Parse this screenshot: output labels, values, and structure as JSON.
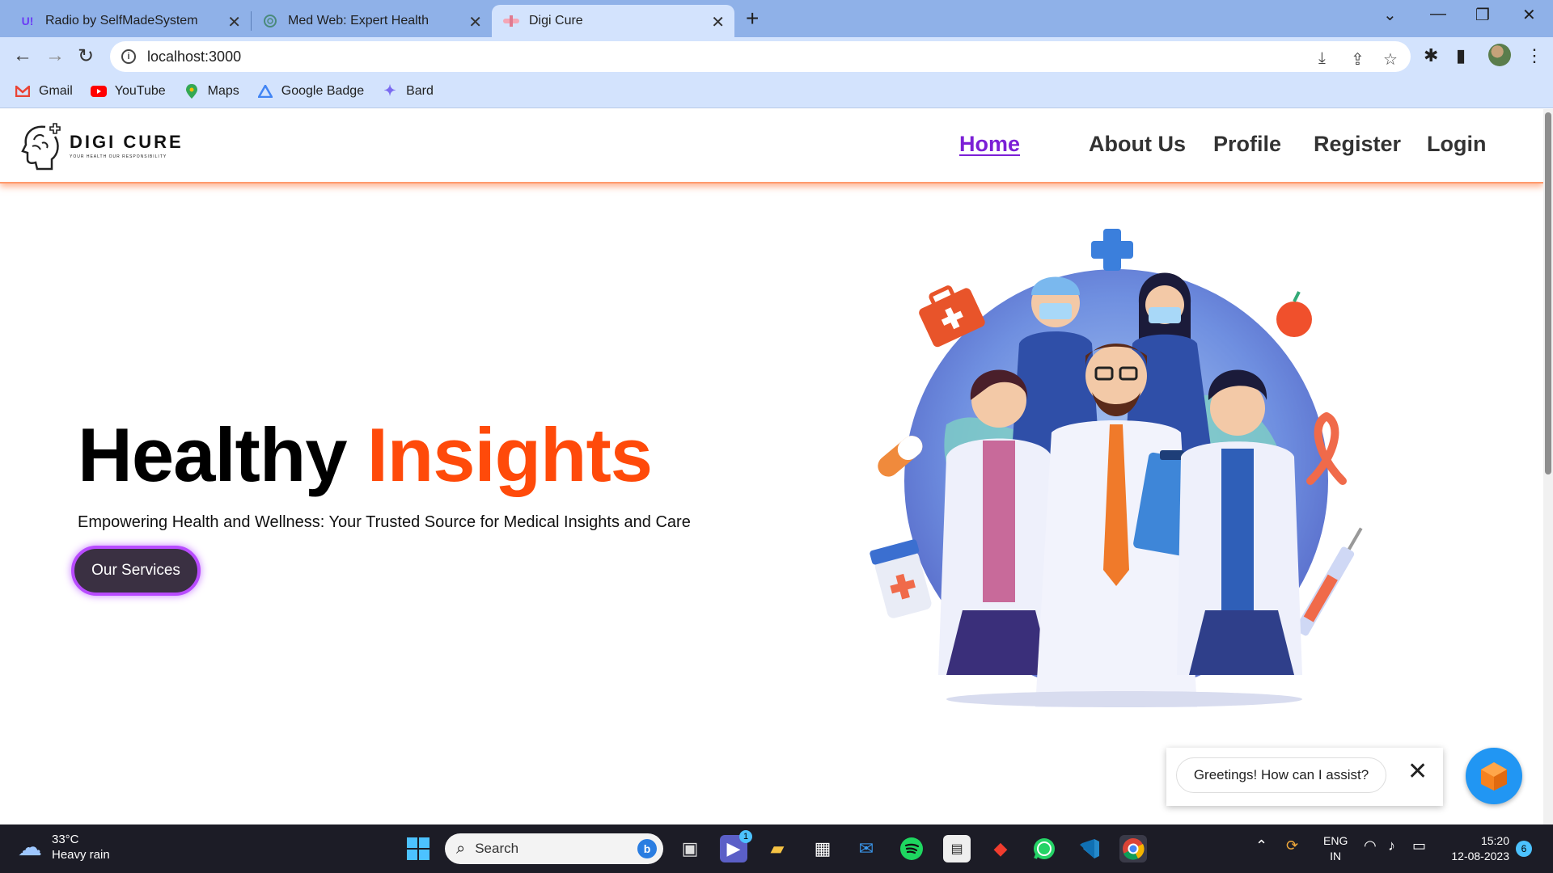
{
  "browser": {
    "tabs": [
      {
        "title": "Radio by SelfMadeSystem",
        "icon": "ui-logo-icon",
        "active": false
      },
      {
        "title": "Med Web: Expert Health",
        "icon": "openai-icon",
        "active": false
      },
      {
        "title": "Digi Cure",
        "icon": "digicure-favicon",
        "active": true
      }
    ],
    "url": "localhost:3000",
    "bookmarks": [
      {
        "label": "Gmail",
        "icon": "gmail-icon"
      },
      {
        "label": "YouTube",
        "icon": "youtube-icon"
      },
      {
        "label": "Maps",
        "icon": "maps-icon"
      },
      {
        "label": "Google Badge",
        "icon": "google-badge-icon"
      },
      {
        "label": "Bard",
        "icon": "bard-icon"
      }
    ]
  },
  "site": {
    "logo_title": "DIGI CURE",
    "logo_tagline": "YOUR HEALTH OUR RESPONSIBILITY",
    "nav": {
      "home": "Home",
      "about": "About Us",
      "profile": "Profile",
      "register": "Register",
      "login": "Login"
    },
    "hero": {
      "title_part1": "Healthy",
      "title_part2": "Insights",
      "subtitle": "Empowering Health and Wellness: Your Trusted Source for Medical Insights and Care",
      "cta": "Our Services"
    },
    "chat": {
      "greeting": "Greetings! How can I assist?"
    },
    "colors": {
      "accent": "#ff4a0a",
      "nav_active": "#7b1fd6",
      "cta_bg": "#3a3042",
      "cta_border": "#b84bff"
    }
  },
  "taskbar": {
    "weather_temp": "33°C",
    "weather_desc": "Heavy rain",
    "search_placeholder": "Search",
    "teams_badge": "1",
    "lang_line1": "ENG",
    "lang_line2": "IN",
    "time": "15:20",
    "date": "12-08-2023",
    "notifications": "6"
  }
}
